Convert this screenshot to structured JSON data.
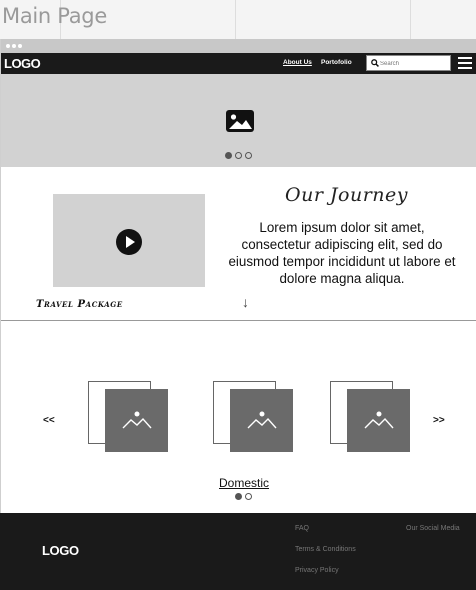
{
  "canvas": {
    "page_title": "Main Page"
  },
  "nav": {
    "logo": "LOGO",
    "links": [
      "About Us",
      "Portofolio"
    ],
    "search_placeholder": "Search"
  },
  "hero": {
    "slides": 3,
    "active_slide": 1
  },
  "journey": {
    "title": "Our Journey",
    "text": "Lorem ipsum dolor sit amet, consectetur adipiscing elit, sed do eiusmod tempor incididunt ut labore et dolore magna aliqua.",
    "arrow": "↓"
  },
  "travel": {
    "title": "Travel Package",
    "prev": "<<",
    "next": ">>",
    "category": "Domestic",
    "pages": 2,
    "active_page": 1
  },
  "footer": {
    "logo": "LOGO",
    "links": [
      "FAQ",
      "Terms & Conditions",
      "Privacy Policy"
    ],
    "social": "Our Social Media"
  },
  "colors": {
    "dark": "#1a1a1a",
    "placeholder_gray": "#d2d2d2",
    "card_gray": "#6a6a6a"
  }
}
